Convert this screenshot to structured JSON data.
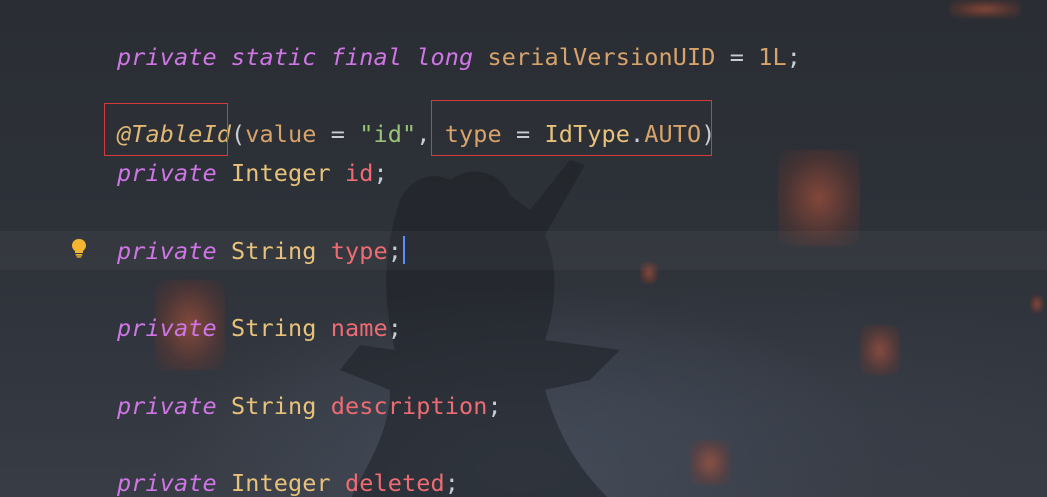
{
  "editor": {
    "lines": [
      {
        "tokens": [
          {
            "text": "private",
            "kind": "kw"
          },
          {
            "text": " ",
            "kind": "plain"
          },
          {
            "text": "static",
            "kind": "kw"
          },
          {
            "text": " ",
            "kind": "plain"
          },
          {
            "text": "final",
            "kind": "kw"
          },
          {
            "text": " ",
            "kind": "plain"
          },
          {
            "text": "long",
            "kind": "kw"
          },
          {
            "text": " ",
            "kind": "plain"
          },
          {
            "text": "serialVersionUID",
            "kind": "ident"
          },
          {
            "text": " = ",
            "kind": "plain"
          },
          {
            "text": "1L",
            "kind": "num"
          },
          {
            "text": ";",
            "kind": "plain"
          }
        ]
      },
      {
        "tokens": [
          {
            "text": "@TableId",
            "kind": "anno"
          },
          {
            "text": "(",
            "kind": "plain"
          },
          {
            "text": "value",
            "kind": "param"
          },
          {
            "text": " = ",
            "kind": "plain"
          },
          {
            "text": "\"id\"",
            "kind": "str"
          },
          {
            "text": ", ",
            "kind": "plain"
          },
          {
            "text": "type",
            "kind": "param"
          },
          {
            "text": " = ",
            "kind": "plain"
          },
          {
            "text": "IdType",
            "kind": "type"
          },
          {
            "text": ".",
            "kind": "plain"
          },
          {
            "text": "AUTO",
            "kind": "enum"
          },
          {
            "text": ")",
            "kind": "plain"
          }
        ]
      },
      {
        "tokens": [
          {
            "text": "private",
            "kind": "kw"
          },
          {
            "text": " ",
            "kind": "plain"
          },
          {
            "text": "Integer",
            "kind": "type"
          },
          {
            "text": " ",
            "kind": "plain"
          },
          {
            "text": "id",
            "kind": "field"
          },
          {
            "text": ";",
            "kind": "plain"
          }
        ]
      },
      {
        "tokens": [
          {
            "text": "private",
            "kind": "kw"
          },
          {
            "text": " ",
            "kind": "plain"
          },
          {
            "text": "String",
            "kind": "type"
          },
          {
            "text": " ",
            "kind": "plain"
          },
          {
            "text": "type",
            "kind": "field"
          },
          {
            "text": ";",
            "kind": "plain"
          }
        ]
      },
      {
        "tokens": [
          {
            "text": "private",
            "kind": "kw"
          },
          {
            "text": " ",
            "kind": "plain"
          },
          {
            "text": "String",
            "kind": "type"
          },
          {
            "text": " ",
            "kind": "plain"
          },
          {
            "text": "name",
            "kind": "field"
          },
          {
            "text": ";",
            "kind": "plain"
          }
        ]
      },
      {
        "tokens": [
          {
            "text": "private",
            "kind": "kw"
          },
          {
            "text": " ",
            "kind": "plain"
          },
          {
            "text": "String",
            "kind": "type"
          },
          {
            "text": " ",
            "kind": "plain"
          },
          {
            "text": "description",
            "kind": "field"
          },
          {
            "text": ";",
            "kind": "plain"
          }
        ]
      },
      {
        "tokens": [
          {
            "text": "private",
            "kind": "kw"
          },
          {
            "text": " ",
            "kind": "plain"
          },
          {
            "text": "Integer",
            "kind": "type"
          },
          {
            "text": " ",
            "kind": "plain"
          },
          {
            "text": "deleted",
            "kind": "field"
          },
          {
            "text": ";",
            "kind": "plain"
          }
        ]
      }
    ],
    "gutter_icon": "intention-bulb-icon",
    "colors": {
      "background": "#2b2f35",
      "keyword": "#cf75e6",
      "type": "#e8c27a",
      "field": "#ef6b73",
      "string": "#98c379",
      "highlight_box": "#d13b3b",
      "caret": "#5c8dff"
    }
  }
}
